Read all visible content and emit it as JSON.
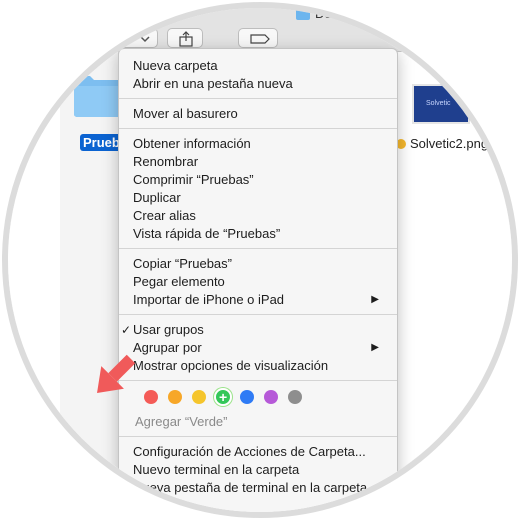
{
  "finder": {
    "path_label": "De",
    "selected_item_label": "Prueb",
    "file_label": "Solvetic2.png",
    "thumbnail_text": "Solvetic"
  },
  "menu": {
    "items": [
      {
        "label": "Nueva carpeta"
      },
      {
        "label": "Abrir en una pestaña nueva"
      },
      {
        "label": "Mover al basurero"
      },
      {
        "label": "Obtener información"
      },
      {
        "label": "Renombrar"
      },
      {
        "label": "Comprimir “Pruebas”"
      },
      {
        "label": "Duplicar"
      },
      {
        "label": "Crear alias"
      },
      {
        "label": "Vista rápida de “Pruebas”"
      },
      {
        "label": "Copiar “Pruebas”"
      },
      {
        "label": "Pegar elemento"
      },
      {
        "label": "Importar de iPhone o iPad",
        "submenu": true
      },
      {
        "label": "Usar grupos",
        "checked": true
      },
      {
        "label": "Agrupar por",
        "submenu": true
      },
      {
        "label": "Mostrar opciones de visualización"
      },
      {
        "label": "Configuración de Acciones de Carpeta..."
      },
      {
        "label": "Nuevo terminal en la carpeta"
      },
      {
        "label": "Nueva pestaña de terminal en la carpeta"
      }
    ],
    "tag_colors": [
      "#f45b57",
      "#f7a728",
      "#f5c52c",
      "#34c759",
      "#2f7bf5",
      "#b659d8",
      "#8e8e8e"
    ],
    "tag_hint": "Agregar “Verde”",
    "submenu_glyph": "▶",
    "check_glyph": "✓"
  },
  "colors": {
    "pointer": "#f05a5a",
    "selection": "#0b63d1",
    "folder": "#6cb5ee"
  }
}
